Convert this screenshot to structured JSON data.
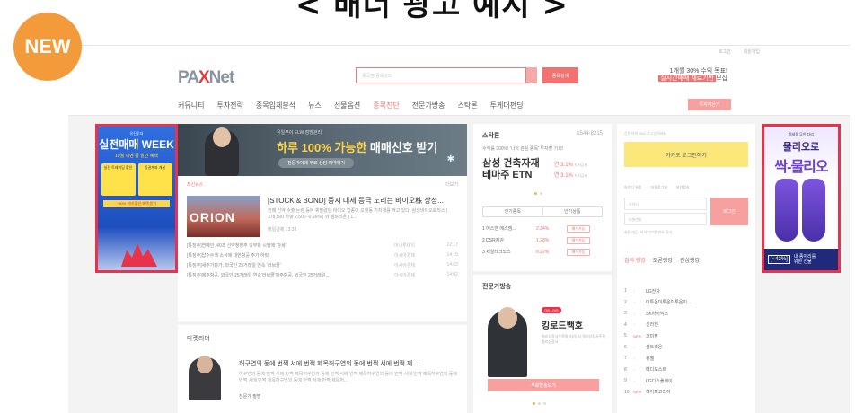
{
  "title": "< 배너 광고 예시 >",
  "badge": "NEW",
  "site": {
    "top_links": [
      "로그인",
      "회원가입"
    ],
    "logo_prefix": "PA",
    "logo_x": "X",
    "logo_suffix": "Net",
    "search_placeholder": "종목명/종목코드",
    "search_button": "종목검색",
    "promo_line1": "1개월 30% 수익 목표!",
    "promo_line2_hl": "실시간매매 재료기반",
    "promo_line2_rest": "모집",
    "nav": [
      "커뮤니티",
      "투자전략",
      "종목입체분석",
      "뉴스",
      "선물옵션",
      "종목진단",
      "전문가방송",
      "스탁론",
      "투게더펀딩"
    ],
    "nav_active_index": 5,
    "nav_button": "투자게산기"
  },
  "ad_left": {
    "brand": "유진투자",
    "title": "실전매매 WEEK",
    "sub": "10월 이벤 중 할인 혜택",
    "card1": "실전 트레이딩 할인",
    "card2": "증권계좌 개설",
    "banner": "~30% 최대 할인 혜택 받기",
    "label": "할인율"
  },
  "hero": {
    "sub": "유일무이 ELW 점방관리",
    "title_a": "하루 100% 가능한",
    "title_b": " 매매신호 받기",
    "button": "전문가이에 무료 상담 예약하기"
  },
  "news": {
    "tab": "최신뉴스",
    "more": "더보기",
    "thumb_text": "ORION",
    "headline": "[STOCK & BOND] 증시 대세 등극 노리는 바이오株 상성...",
    "desc": "한때 신약 수출 논란 등에 휘말렸던 바이오 업종이 오랫동 기지개를 켜고 있다. 삼성바이오로직스 | 378,500 하향 2,500 -0.66% | 와 셀트리온 | 1...",
    "meta": "매일경제   13:33",
    "rows": [
      {
        "t": "[특징주]연예인, 40조 신약청정주 의무화 시행에 '강세'",
        "s": "머니투데이",
        "time": "12:17"
      },
      {
        "t": "[특징주]압수수색 소식에 대한항공 주가 하락",
        "s": "아시아경제",
        "time": "14:15"
      },
      {
        "t": "[특징주]새주가평가, 외국인 25거래일 연속 '러브콜'",
        "s": "아시아경제",
        "time": "14:02"
      },
      {
        "t": "[특징주]제주항공, 외국인 25거래일 연속'러브콜'제주항공, 외국인 25거래일...",
        "s": "아시아경제",
        "time": "14:02"
      }
    ]
  },
  "column": {
    "title": "마켓리더",
    "headline": "허구연의 동에 번쩍 서에 번쩍 제목허구연의 동에 번쩍 서에 번쩍 제...",
    "desc": "허구연의 동에 번쩍 서에 번쩍 제목허구연의 동에 번쩍 서에 번쩍 제목허구연의 동에 번쩍 서에 번쩍 제목허구연의 동에 번쩍 서에 번쩍 제목허구연의 동에 번쩍 서에 번쩍 제목허...",
    "author": "전문가 필명"
  },
  "stock": {
    "title": "스탁론",
    "phone": "1544-8215",
    "note": "수익률 300%! '나의 관심 종목' 투자할 기회!",
    "name": "삼성 건축자재 테마주 ETN",
    "pct1": "연 3.1%",
    "pct2": "연 3.1%",
    "pct_label": "최저금리",
    "tab1": "인기종목",
    "tab2": "인기상품",
    "list": [
      {
        "n": "1  에스엠 에스엠...",
        "p": "2.34%",
        "b": "매수가능"
      },
      {
        "n": "2  DSR제강",
        "p": "1.28%",
        "b": "매수가능"
      },
      {
        "n": "3  제일테크노스",
        "p": "0.22%",
        "b": "매수가능"
      }
    ]
  },
  "broadcast": {
    "title": "전문가방송",
    "live": "ON LIVE",
    "name": "킹로드백호",
    "desc": "릴리상장사주목릴리상장사 릴리상장사주목릴리상장사",
    "time": "05.25 08:30",
    "button": "무료방송보기"
  },
  "login": {
    "note": "간편하게 SNS 로그인하세요",
    "kakao": "카카오 로그인하기",
    "opts": [
      "아이디 저장",
      "자동로그인",
      "보안접속"
    ],
    "id_placeholder": "아이디",
    "pw_placeholder": "비밀번호",
    "button": "로그인",
    "join": "회원가입 | 아이디/비밀번호 찾기",
    "tabs": [
      "검색 랭킹",
      "토론랭킹",
      "관심랭킹"
    ]
  },
  "ranking": [
    {
      "num": "1",
      "ch": "↑",
      "nm": "LG전자",
      "new": false
    },
    {
      "num": "2",
      "ch": "↑",
      "nm": "미투온미투온미투온미...",
      "new": false
    },
    {
      "num": "3",
      "ch": "↑",
      "nm": "SK하이닉스",
      "new": false
    },
    {
      "num": "4",
      "ch": "↑",
      "nm": "신라젠",
      "new": false
    },
    {
      "num": "5",
      "ch": "NEW",
      "nm": "코미팜",
      "new": true
    },
    {
      "num": "6",
      "ch": "↓",
      "nm": "셀트리온",
      "new": false
    },
    {
      "num": "7",
      "ch": "↑",
      "nm": "휴젤",
      "new": false
    },
    {
      "num": "8",
      "ch": "↑",
      "nm": "메디포스트",
      "new": false
    },
    {
      "num": "9",
      "ch": "↑",
      "nm": "LG디스플레이",
      "new": false
    },
    {
      "num": "10",
      "ch": "NEW",
      "nm": "헤어피코리아",
      "new": true
    }
  ],
  "ad_right": {
    "line1": "정세동 무인 다리",
    "line2": "물리오로",
    "line3": "싹-물리오",
    "pct": "[~42%]",
    "txt1": "내 종아리를",
    "txt2": "위한 선물"
  },
  "colors": {
    "accent": "#f27272",
    "badge": "#f39a3b",
    "ad_border": "#e8334a"
  }
}
